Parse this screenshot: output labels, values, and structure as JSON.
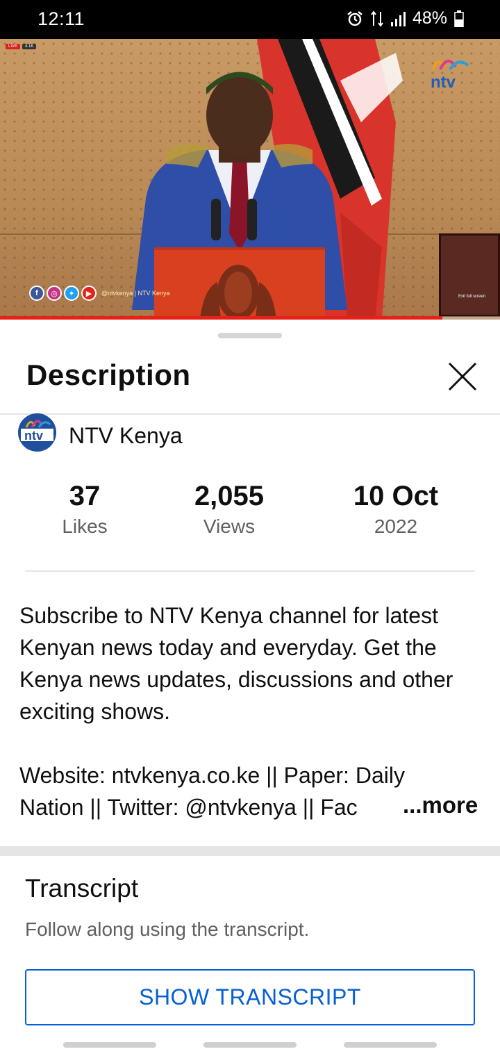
{
  "status_bar": {
    "time": "12:11",
    "battery": "48%",
    "icons": [
      "alarm-icon",
      "data-arrows-icon",
      "signal-icon",
      "battery-icon"
    ]
  },
  "video": {
    "live_badge": [
      "LIVE",
      "4.1K"
    ],
    "social_handle": "@ntvkenya | NTV Kenya",
    "overlay_label": "Exit full screen",
    "progress_fraction": 0.885,
    "progress_color": "#e62117"
  },
  "sheet": {
    "title": "Description",
    "close_icon": "close-icon"
  },
  "channel": {
    "name": "NTV Kenya"
  },
  "stats": [
    {
      "value": "37",
      "label": "Likes"
    },
    {
      "value": "2,055",
      "label": "Views"
    },
    {
      "value": "10 Oct",
      "label": "2022"
    }
  ],
  "description": {
    "paragraph1": "Subscribe to NTV Kenya channel for latest Kenyan news today and everyday. Get the Kenya news updates, discussions and other exciting shows.",
    "line1": "Website: ntvkenya.co.ke || Paper: Daily",
    "line2": "Nation || Twitter: @ntvkenya || Fac",
    "more_label": "...more"
  },
  "transcript": {
    "title": "Transcript",
    "subtitle": "Follow along using the transcript.",
    "button_label": "SHOW TRANSCRIPT",
    "button_color": "#065fd4"
  }
}
